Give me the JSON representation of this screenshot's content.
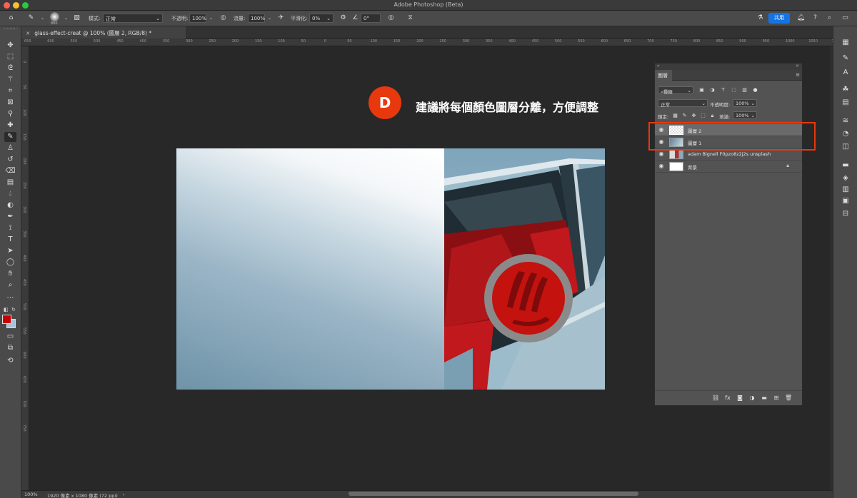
{
  "window": {
    "title": "Adobe Photoshop (Beta)"
  },
  "options_bar": {
    "mode_label": "模式:",
    "mode_value": "正常",
    "opacity_label": "不透明:",
    "opacity_value": "100%",
    "flow_label": "流量:",
    "flow_value": "100%",
    "smoothing_label": "平滑化:",
    "smoothing_value": "0%",
    "angle_value": "0°",
    "brush_size": "800",
    "share_label": "共用"
  },
  "document": {
    "tab_label": "glass-effect-creat @ 100% (圖層 2, RGB/8) *"
  },
  "rulers": {
    "h_ticks": [
      "650",
      "600",
      "550",
      "500",
      "450",
      "400",
      "350",
      "300",
      "250",
      "200",
      "150",
      "100",
      "50",
      "0",
      "50",
      "100",
      "150",
      "200",
      "250",
      "300",
      "350",
      "400",
      "450",
      "500",
      "550",
      "600",
      "650",
      "700",
      "750",
      "800",
      "850",
      "900",
      "950",
      "1000",
      "1050",
      "1100",
      "1150",
      "1200",
      "1250",
      "1300",
      "1350",
      "1400",
      "1450",
      "1500",
      "1550",
      "1600",
      "1650",
      "1700",
      "1750",
      "1800",
      "1850",
      "1900",
      "1950",
      "2000"
    ],
    "v_ticks": [
      "0",
      "50",
      "100",
      "150",
      "200",
      "250",
      "300",
      "350",
      "400",
      "450",
      "500",
      "550",
      "600",
      "650",
      "700",
      "750"
    ]
  },
  "annotation": {
    "badge": "D",
    "text": "建議將每個顏色圖層分離，方便調整",
    "badge_color": "#e8380d"
  },
  "layers_panel": {
    "tab_label": "圖層",
    "filter_kind": "種類",
    "blend_mode": "正常",
    "opacity_label": "不透明度:",
    "opacity_value": "100%",
    "lock_label": "鎖定:",
    "fill_label": "填滿:",
    "fill_value": "100%",
    "layers": [
      {
        "name": "圖層 2",
        "visible": true,
        "selected": true
      },
      {
        "name": "圖層 1",
        "visible": true,
        "selected": false
      },
      {
        "name": "adam Bignell F0pzo8z2j2s unsplash",
        "visible": true,
        "selected": false
      },
      {
        "name": "背景",
        "visible": true,
        "selected": false,
        "locked": true
      }
    ],
    "highlight_color": "#e8380d"
  },
  "status_bar": {
    "zoom": "100%",
    "doc_size": "1920 像素 x 1080 像素 (72 ppi)"
  },
  "colors": {
    "foreground": "#c80000",
    "background": "#a8c4dc"
  }
}
